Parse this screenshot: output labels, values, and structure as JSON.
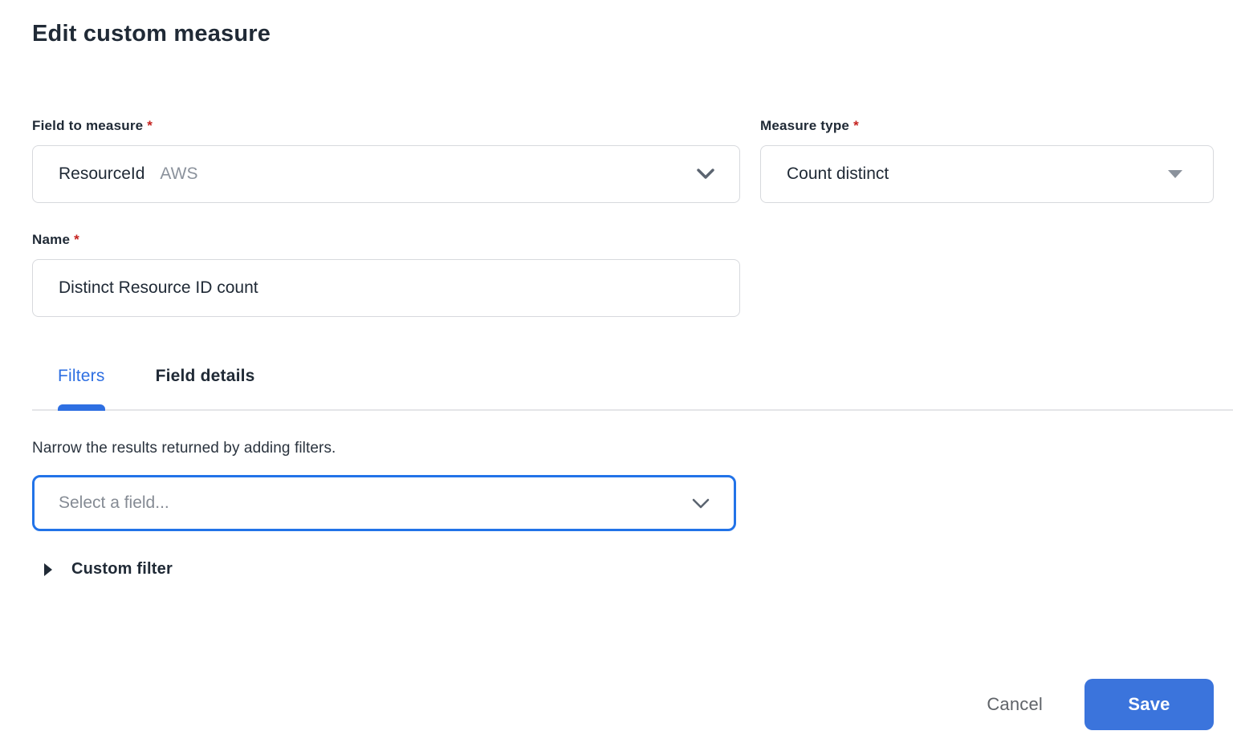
{
  "page": {
    "title": "Edit custom measure"
  },
  "colors": {
    "accent_blue": "#2e6fe2",
    "save_button_blue": "#3b74dc",
    "focus_border_blue": "#2273e8",
    "required_red": "#c5221f",
    "text_dark": "#202a36",
    "text_gray": "#8b929c",
    "border_gray": "#d7d9dd"
  },
  "form": {
    "field_to_measure": {
      "label": "Field to measure",
      "required_mark": "*",
      "value": "ResourceId",
      "tag": "AWS"
    },
    "measure_type": {
      "label": "Measure type",
      "required_mark": "*",
      "value": "Count distinct"
    },
    "name": {
      "label": "Name",
      "required_mark": "*",
      "value": "Distinct Resource ID count"
    }
  },
  "tabs": [
    {
      "label": "Filters",
      "active": true
    },
    {
      "label": "Field details",
      "active": false
    }
  ],
  "filters_section": {
    "description": "Narrow the results returned by adding filters.",
    "field_select_placeholder": "Select a field...",
    "custom_filter_label": "Custom filter"
  },
  "footer": {
    "cancel_label": "Cancel",
    "save_label": "Save"
  },
  "icons": {
    "field_dropdown": "chevron-down-icon",
    "measure_dropdown": "caret-down-icon",
    "filter_dropdown": "chevron-down-icon",
    "custom_filter": "caret-right-icon"
  }
}
